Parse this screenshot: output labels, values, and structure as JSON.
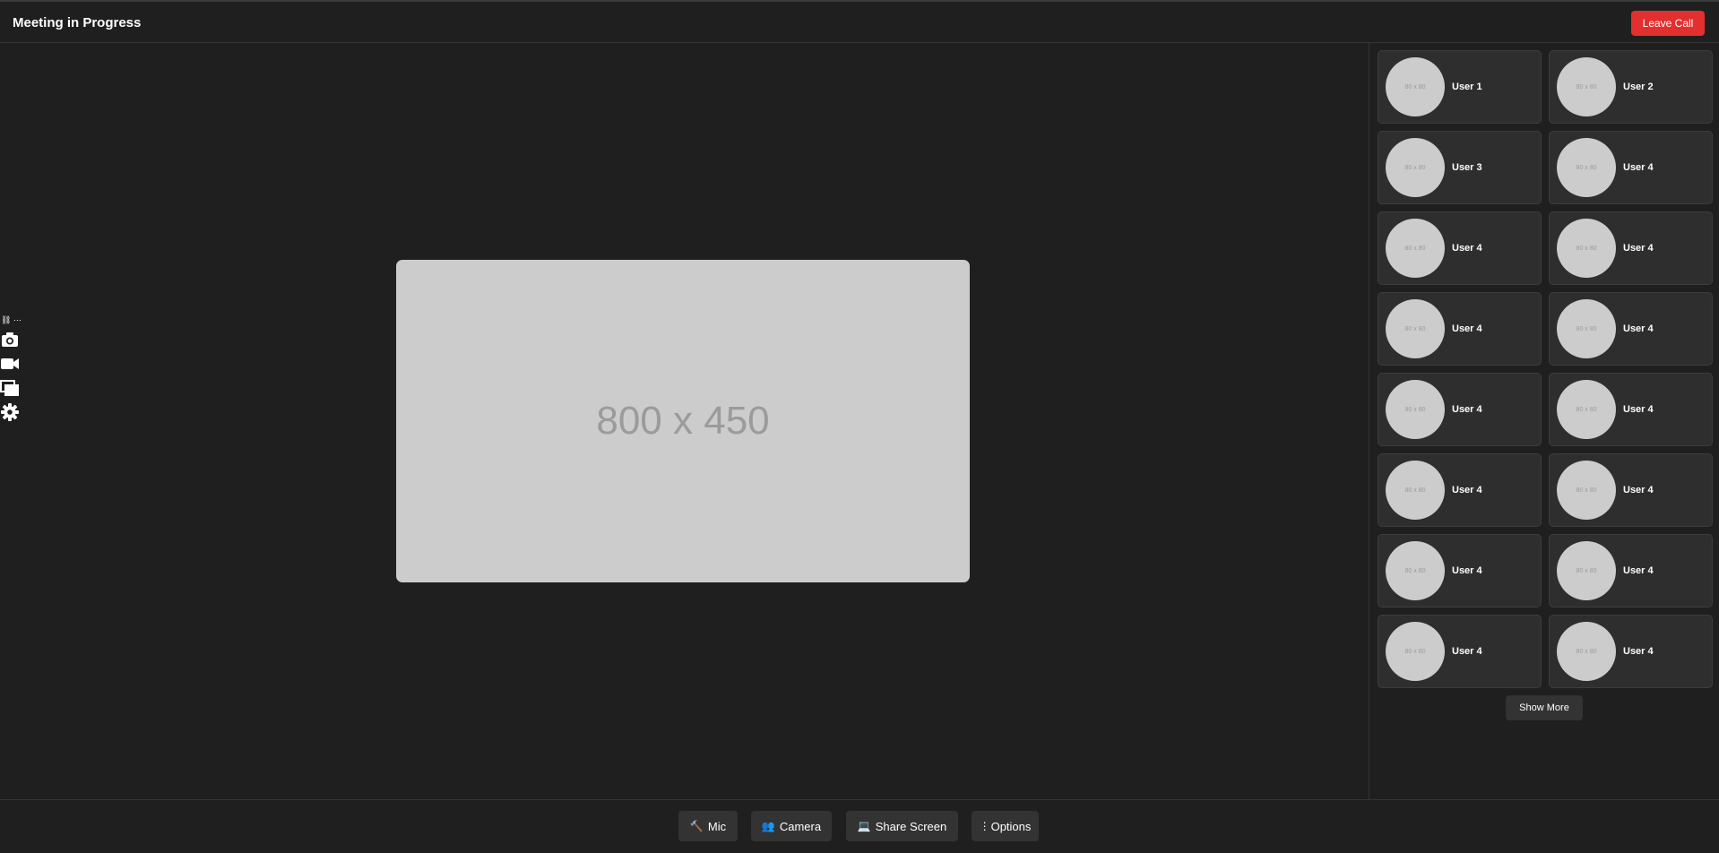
{
  "header": {
    "title": "Meeting in Progress",
    "leave_label": "Leave Call",
    "leave_color": "#e3302f"
  },
  "left_tools": {
    "mini_label": "⛓ ⋯",
    "icons": [
      "camera-icon",
      "video-icon",
      "screens-icon",
      "gear-icon"
    ]
  },
  "stage": {
    "placeholder": "800 x 450"
  },
  "participants": {
    "avatar_placeholder": "80 x 80",
    "tiles": [
      {
        "name": "User 1"
      },
      {
        "name": "User 2"
      },
      {
        "name": "User 3"
      },
      {
        "name": "User 4"
      },
      {
        "name": "User 4"
      },
      {
        "name": "User 4"
      },
      {
        "name": "User 4"
      },
      {
        "name": "User 4"
      },
      {
        "name": "User 4"
      },
      {
        "name": "User 4"
      },
      {
        "name": "User 4"
      },
      {
        "name": "User 4"
      },
      {
        "name": "User 4"
      },
      {
        "name": "User 4"
      },
      {
        "name": "User 4"
      },
      {
        "name": "User 4"
      }
    ],
    "show_more_label": "Show More"
  },
  "controls": {
    "mic": {
      "icon": "hammer-icon",
      "glyph": "🔨",
      "label": "Mic"
    },
    "camera": {
      "icon": "people-icon",
      "glyph": "👥",
      "label": "Camera"
    },
    "share": {
      "icon": "laptop-icon",
      "glyph": "💻",
      "label": "Share Screen"
    },
    "options": {
      "icon": "more-vertical-icon",
      "glyph": "⋮",
      "label": "Options"
    }
  },
  "colors": {
    "background": "#1f1f1f",
    "tile": "#2e2e2e",
    "button": "#333333",
    "placeholder": "#cccccc"
  }
}
